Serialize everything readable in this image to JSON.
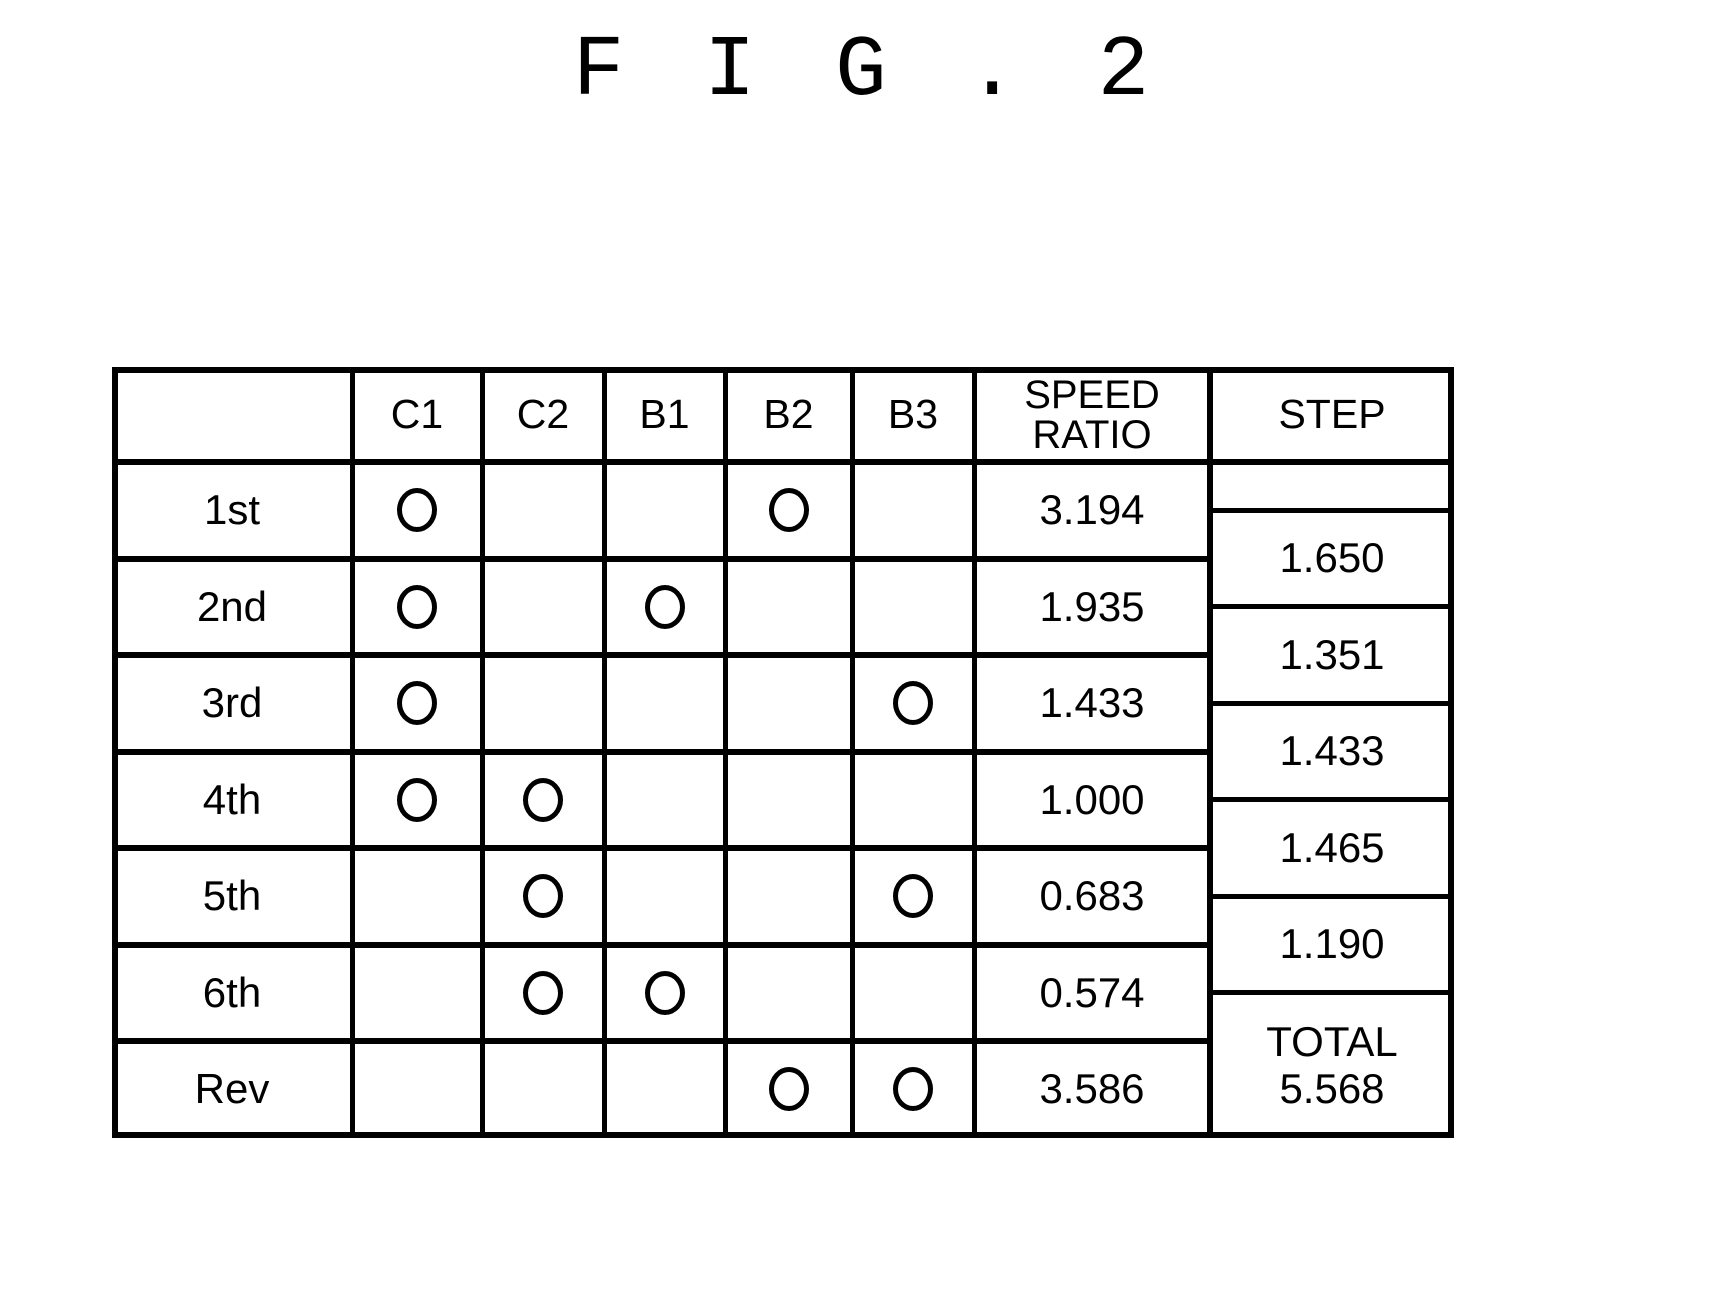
{
  "figure": {
    "title": "F I G . 2"
  },
  "table": {
    "columns": [
      {
        "key": "gear",
        "label": ""
      },
      {
        "key": "C1",
        "label": "C1"
      },
      {
        "key": "C2",
        "label": "C2"
      },
      {
        "key": "B1",
        "label": "B1"
      },
      {
        "key": "B2",
        "label": "B2"
      },
      {
        "key": "B3",
        "label": "B3"
      },
      {
        "key": "ratio",
        "label": "SPEED\nRATIO"
      },
      {
        "key": "step",
        "label": "STEP"
      }
    ],
    "engagement_symbol": "O",
    "rows": [
      {
        "gear": "1st",
        "C1": true,
        "C2": false,
        "B1": false,
        "B2": true,
        "B3": false,
        "ratio": "3.194"
      },
      {
        "gear": "2nd",
        "C1": true,
        "C2": false,
        "B1": true,
        "B2": false,
        "B3": false,
        "ratio": "1.935"
      },
      {
        "gear": "3rd",
        "C1": true,
        "C2": false,
        "B1": false,
        "B2": false,
        "B3": true,
        "ratio": "1.433"
      },
      {
        "gear": "4th",
        "C1": true,
        "C2": true,
        "B1": false,
        "B2": false,
        "B3": false,
        "ratio": "1.000"
      },
      {
        "gear": "5th",
        "C1": false,
        "C2": true,
        "B1": false,
        "B2": false,
        "B3": true,
        "ratio": "0.683"
      },
      {
        "gear": "6th",
        "C1": false,
        "C2": true,
        "B1": true,
        "B2": false,
        "B3": false,
        "ratio": "0.574"
      },
      {
        "gear": "Rev",
        "C1": false,
        "C2": false,
        "B1": false,
        "B2": true,
        "B3": true,
        "ratio": "3.586"
      }
    ],
    "steps": [
      {
        "between": "1st-2nd",
        "value": "1.650"
      },
      {
        "between": "2nd-3rd",
        "value": "1.351"
      },
      {
        "between": "3rd-4th",
        "value": "1.433"
      },
      {
        "between": "4th-5th",
        "value": "1.465"
      },
      {
        "between": "5th-6th",
        "value": "1.190"
      }
    ],
    "total": {
      "label": "TOTAL",
      "value": "5.568"
    }
  }
}
